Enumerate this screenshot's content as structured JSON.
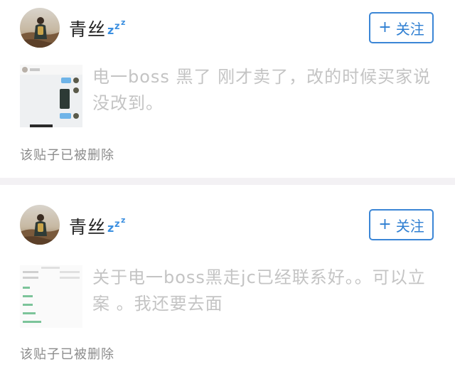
{
  "posts": [
    {
      "username": "青丝",
      "status_icon": "sleep-zzz-icon",
      "follow_label": "关注",
      "thumbnail": "chat-screenshot-thumbnail",
      "content": "电一boss  黑了  刚才卖了，改的时候买家说没改到。",
      "deleted_note": "该贴子已被删除"
    },
    {
      "username": "青丝",
      "status_icon": "sleep-zzz-icon",
      "follow_label": "关注",
      "thumbnail": "settings-list-screenshot-thumbnail",
      "content": "关于电一boss黑走jc已经联系好。。可以立案 。我还要去面",
      "deleted_note": "该贴子已被删除"
    }
  ],
  "colors": {
    "follow_blue": "#2f7fd2",
    "zzz_blue": "#3b8fe0",
    "separator": "#f3f1f4",
    "faded_text": "#c4c4c4",
    "note_text": "#8c8c8c"
  }
}
